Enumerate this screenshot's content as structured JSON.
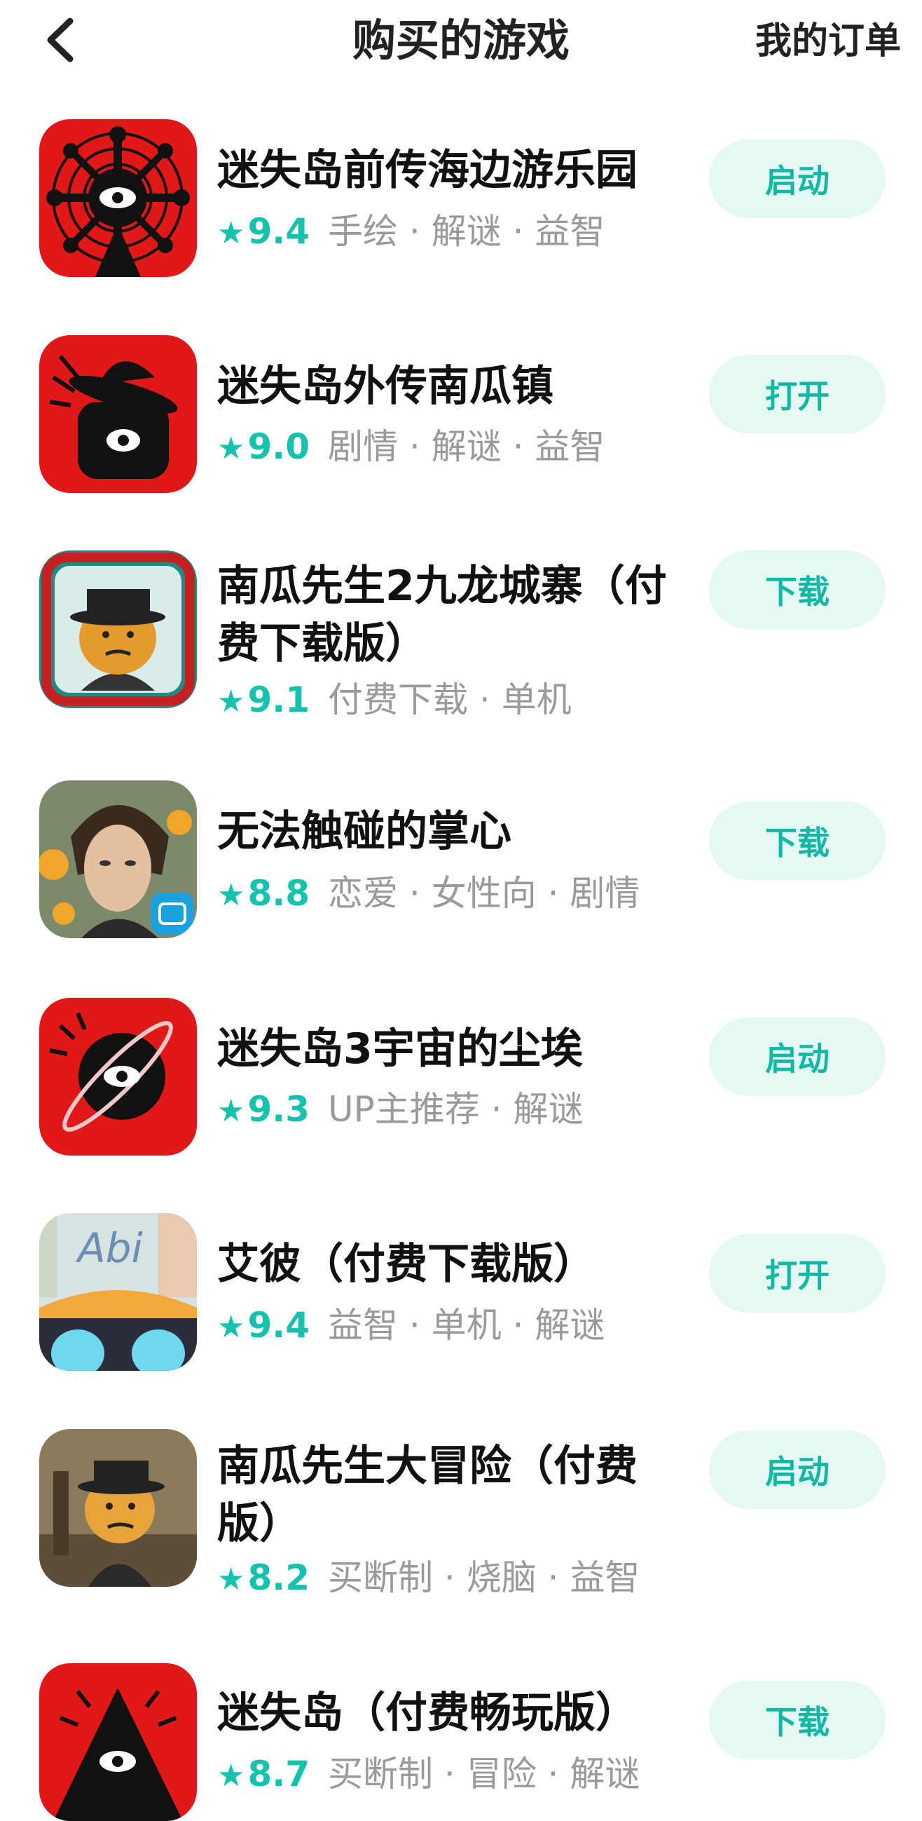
{
  "header": {
    "title": "购买的游戏",
    "orders_label": "我的订单"
  },
  "games": [
    {
      "title": "迷失岛前传海边游乐园",
      "rating": "9.4",
      "tags": "手绘 · 解谜 · 益智",
      "action": "启动",
      "icon": "lost-island-prequel-icon"
    },
    {
      "title": "迷失岛外传南瓜镇",
      "rating": "9.0",
      "tags": "剧情 · 解谜 · 益智",
      "action": "打开",
      "icon": "lost-island-pumpkin-town-icon"
    },
    {
      "title": "南瓜先生2九龙城寨（付费下载版）",
      "rating": "9.1",
      "tags": "付费下载 · 单机",
      "action": "下载",
      "icon": "mr-pumpkin-2-icon"
    },
    {
      "title": "无法触碰的掌心",
      "rating": "8.8",
      "tags": "恋爱 · 女性向 · 剧情",
      "action": "下载",
      "icon": "untouchable-palm-icon"
    },
    {
      "title": "迷失岛3宇宙的尘埃",
      "rating": "9.3",
      "tags": "UP主推荐 · 解谜",
      "action": "启动",
      "icon": "lost-island-3-icon"
    },
    {
      "title": "艾彼（付费下载版）",
      "rating": "9.4",
      "tags": "益智 · 单机 · 解谜",
      "action": "打开",
      "icon": "abi-icon"
    },
    {
      "title": "南瓜先生大冒险（付费版）",
      "rating": "8.2",
      "tags": "买断制 · 烧脑 · 益智",
      "action": "启动",
      "icon": "mr-pumpkin-adventure-icon"
    },
    {
      "title": "迷失岛（付费畅玩版）",
      "rating": "8.7",
      "tags": "买断制 · 冒险 · 解谜",
      "action": "下载",
      "icon": "lost-island-icon"
    }
  ],
  "icons": {
    "back": "chevron-left-icon",
    "star": "★"
  },
  "colors": {
    "accent": "#14c2ad",
    "button_bg": "#e4f8f4",
    "tag_text": "#9a9a9a",
    "icon_red": "#e01818"
  }
}
